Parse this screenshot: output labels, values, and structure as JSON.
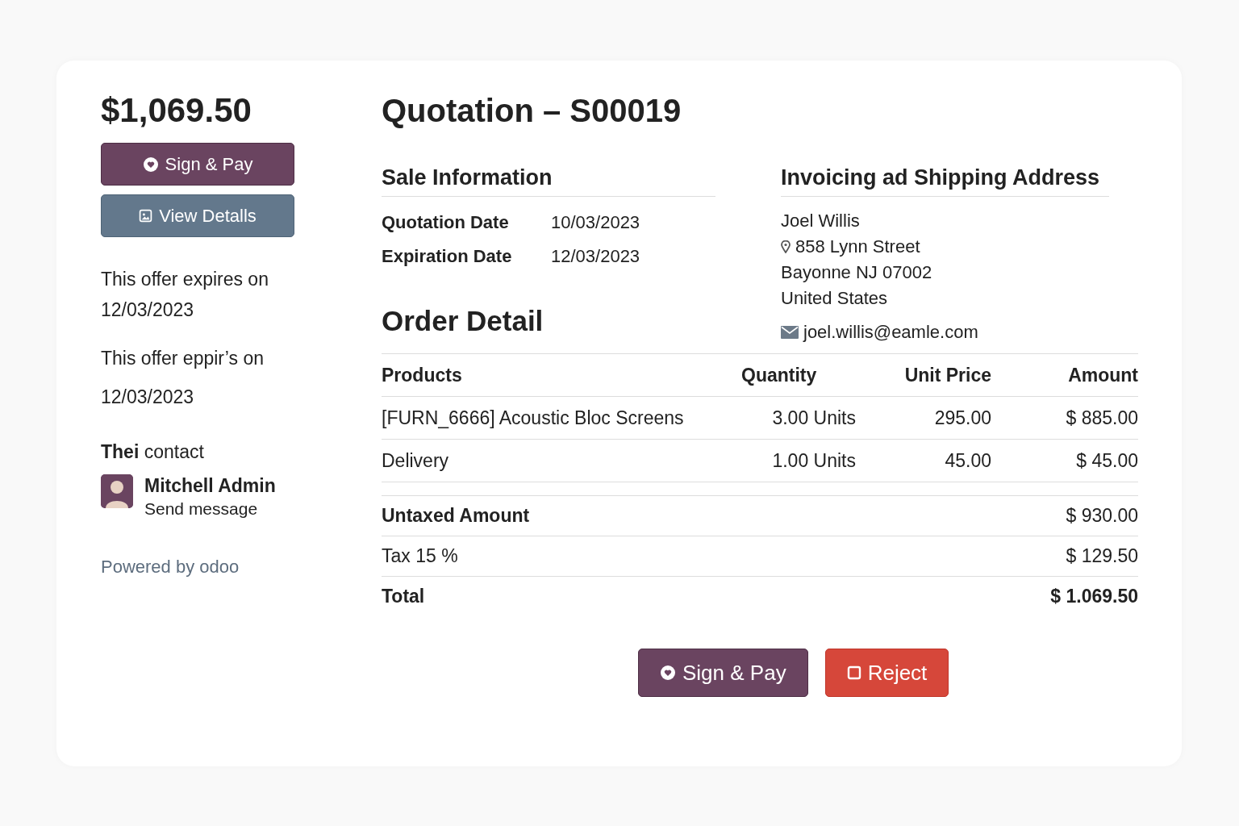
{
  "sidebar": {
    "amount": "$1,069.50",
    "buttons": [
      {
        "label": "Sign & Pay",
        "kind": "primary"
      },
      {
        "label": "View Detalls",
        "kind": "secondary"
      }
    ],
    "notes": [
      {
        "text": "This offer expires on",
        "date": "12/03/2023"
      },
      {
        "text": "This offer eppir’s on",
        "date": "12/03/2023"
      }
    ],
    "contact": {
      "heading": "**Thei** contact",
      "name": "Mitchell Admin",
      "link": "Send message"
    },
    "powered_by": "Powered by odoo"
  },
  "title": "Quotation – S00019",
  "sale_information": {
    "heading": "Sale Information",
    "fields": [
      {
        "label": "Quotation Date",
        "value": "10/03/2023"
      },
      {
        "label": "Expiration Date",
        "value": "12/03/2023"
      }
    ]
  },
  "address": {
    "heading": "Invoicing ad Shipping Address",
    "name": "Joel Willis",
    "street": "858 Lynn Street",
    "city": "Bayonne NJ 07002",
    "country": "United States",
    "email": "joel.willis@eamle.com"
  },
  "order_detail": {
    "heading": "Order Detail",
    "columns": [
      "Products",
      "Quantity",
      "Unit Price",
      "Amount"
    ],
    "rows": [
      {
        "product": "[FURN_6666] Acoustic Bloc Screens",
        "quantity": "3.00 Units",
        "unit_price": "295.00",
        "amount": "$ 885.00"
      },
      {
        "product": "Delivery",
        "quantity": "1.00 Units",
        "unit_price": "45.00",
        "amount": "$ 45.00"
      }
    ],
    "totals": [
      {
        "label": "Untaxed Amount",
        "value": "$ 930.00",
        "kind": "subtotal"
      },
      {
        "label": "Tax 15 %",
        "value": "$ 129.50",
        "kind": "tax"
      },
      {
        "label": "Total",
        "value": "$ 1.069.50",
        "kind": "total"
      }
    ]
  },
  "actions": [
    {
      "label": "Sign & Pay",
      "kind": "primary"
    },
    {
      "label": "Reject",
      "kind": "danger"
    }
  ]
}
